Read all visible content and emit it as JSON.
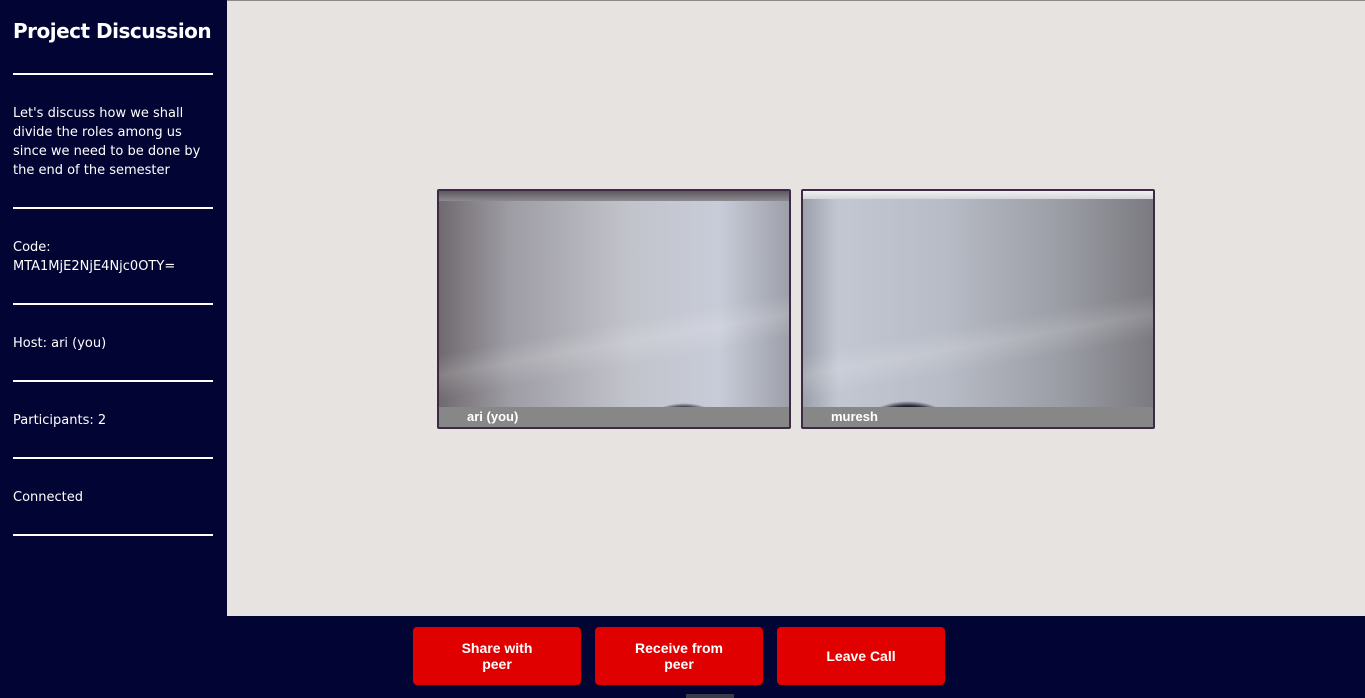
{
  "sidebar": {
    "title": "Project Discussion",
    "description": "Let's discuss how we shall divide the roles among us since we need to be done by the end of the semester",
    "code_label": "Code:",
    "code_value": "MTA1MjE2NjE4Njc0OTY=",
    "host": "Host: ari (you)",
    "participants": "Participants: 2",
    "status": "Connected"
  },
  "videos": [
    {
      "name": "ari (you)"
    },
    {
      "name": "muresh"
    }
  ],
  "controls": {
    "share": "Share with peer",
    "receive": "Receive from peer",
    "leave": "Leave Call"
  },
  "colors": {
    "navy": "#020433",
    "stage": "#e6e3e1",
    "button_red": "#e00000"
  }
}
